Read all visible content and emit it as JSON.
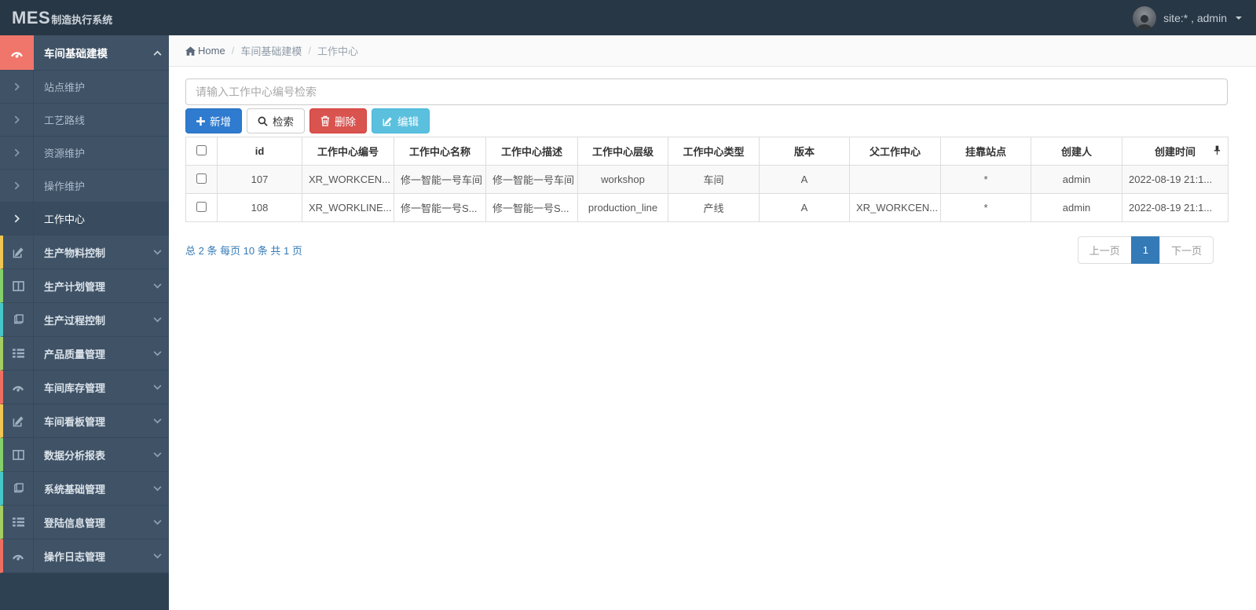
{
  "app": {
    "logo_main": "MES",
    "logo_sub": "制造执行系统",
    "user_label": "site:* , admin"
  },
  "breadcrumb": {
    "home": "Home",
    "section": "车间基础建模",
    "current": "工作中心",
    "separator": "/"
  },
  "search": {
    "placeholder": "请输入工作中心编号检索",
    "value": ""
  },
  "toolbar": {
    "add": "新增",
    "search": "检索",
    "delete": "删除",
    "edit": "编辑"
  },
  "sidebar": {
    "active_group": {
      "label": "车间基础建模",
      "icon": "tachometer-icon"
    },
    "children": [
      {
        "label": "站点维护"
      },
      {
        "label": "工艺路线"
      },
      {
        "label": "资源维护"
      },
      {
        "label": "操作维护"
      },
      {
        "label": "工作中心",
        "active": true
      }
    ],
    "groups": [
      {
        "label": "生产物料控制",
        "icon": "pencil-square-icon",
        "accent": "#f0c553"
      },
      {
        "label": "生产计划管理",
        "icon": "columns-icon",
        "accent": "#84d06a"
      },
      {
        "label": "生产过程控制",
        "icon": "book-icon",
        "accent": "#46c6c9"
      },
      {
        "label": "产品质量管理",
        "icon": "th-list-icon",
        "accent": "#a4cd62"
      },
      {
        "label": "车间库存管理",
        "icon": "tachometer-icon",
        "accent": "#ee6f62"
      },
      {
        "label": "车间看板管理",
        "icon": "pencil-square-icon",
        "accent": "#f0c553"
      },
      {
        "label": "数据分析报表",
        "icon": "columns-icon",
        "accent": "#84d06a"
      },
      {
        "label": "系统基础管理",
        "icon": "book-icon",
        "accent": "#46c6c9"
      },
      {
        "label": "登陆信息管理",
        "icon": "th-list-icon",
        "accent": "#a4cd62"
      },
      {
        "label": "操作日志管理",
        "icon": "tachometer-icon",
        "accent": "#ee6f62"
      }
    ]
  },
  "table": {
    "columns": [
      "id",
      "工作中心编号",
      "工作中心名称",
      "工作中心描述",
      "工作中心层级",
      "工作中心类型",
      "版本",
      "父工作中心",
      "挂靠站点",
      "创建人",
      "创建时间"
    ],
    "rows": [
      {
        "cells": [
          "107",
          "XR_WORKCEN...",
          "修一智能一号车间",
          "修一智能一号车间",
          "workshop",
          "车间",
          "A",
          "",
          "*",
          "admin",
          "2022-08-19 21:1..."
        ]
      },
      {
        "cells": [
          "108",
          "XR_WORKLINE...",
          "修一智能一号S...",
          "修一智能一号S...",
          "production_line",
          "产线",
          "A",
          "XR_WORKCEN...",
          "*",
          "admin",
          "2022-08-19 21:1..."
        ]
      }
    ]
  },
  "pagination": {
    "summary": "总 2 条 每页 10 条 共 1 页",
    "prev": "上一页",
    "current": "1",
    "next": "下一页"
  },
  "colors": {
    "navbar_bg": "#273746",
    "sidebar_item_bg": "#3f5266",
    "sidebar_footer_bg": "#2e4153",
    "active_icon_bg": "#f0756a",
    "primary_button": "#2e7bd0",
    "danger_button": "#d9534f",
    "info_button": "#5bc0de",
    "link_blue": "#337ab7"
  }
}
